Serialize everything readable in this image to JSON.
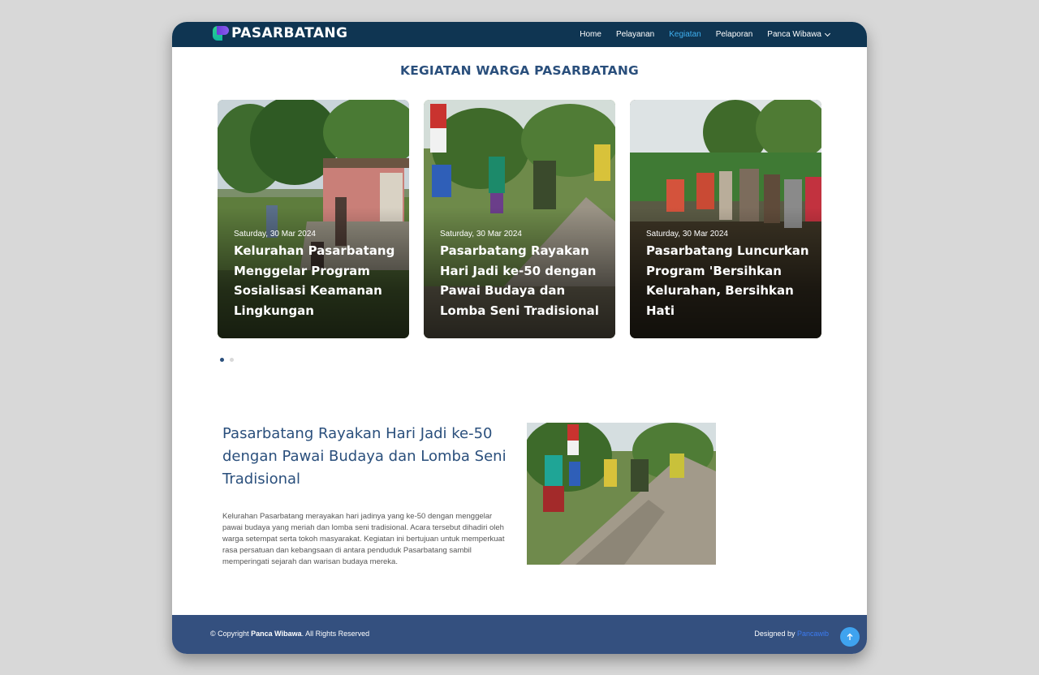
{
  "navbar": {
    "brand": "PASARBATANG",
    "items": [
      {
        "label": "Home",
        "active": false
      },
      {
        "label": "Pelayanan",
        "active": false
      },
      {
        "label": "Kegiatan",
        "active": true
      },
      {
        "label": "Pelaporan",
        "active": false
      },
      {
        "label": "Panca Wibawa",
        "active": false,
        "dropdown": true
      }
    ]
  },
  "section": {
    "title": "KEGIATAN WARGA PASARBATANG"
  },
  "cards": [
    {
      "date": "Saturday, 30 Mar 2024",
      "title": "Kelurahan Pasarbatang Menggelar Program Sosialisasi Keamanan Lingkungan"
    },
    {
      "date": "Saturday, 30 Mar 2024",
      "title": "Pasarbatang Rayakan Hari Jadi ke-50 dengan Pawai Budaya dan Lomba Seni Tradisional"
    },
    {
      "date": "Saturday, 30 Mar 2024",
      "title": "Pasarbatang Luncurkan Program 'Bersihkan Kelurahan, Bersihkan Hati"
    }
  ],
  "carousel": {
    "pages": 2,
    "current": 1
  },
  "article": {
    "title": "Pasarbatang Rayakan Hari Jadi ke-50 dengan Pawai Budaya dan Lomba Seni Tradisional",
    "body": "Kelurahan Pasarbatang merayakan hari jadinya yang ke-50 dengan menggelar pawai budaya yang meriah dan lomba seni tradisional. Acara tersebut dihadiri oleh warga setempat serta tokoh masyarakat. Kegiatan ini bertujuan untuk memperkuat rasa persatuan dan kebangsaan di antara penduduk Pasarbatang sambil memperingati sejarah dan warisan budaya mereka."
  },
  "footer": {
    "copyright_prefix": "© Copyright ",
    "copyright_name": "Panca Wibawa",
    "copyright_suffix": ". All Rights Reserved",
    "designed_prefix": "Designed by ",
    "designed_link": "Pancawib"
  },
  "colors": {
    "navbar": "#0f3552",
    "accent_nav": "#3fb0f0",
    "title": "#2a4f7c",
    "footer": "#34507f",
    "to_top": "#3fa3ef"
  },
  "icons": {
    "logo": "logo-mark-icon",
    "dropdown": "chevron-down-icon",
    "to_top": "arrow-up-icon"
  }
}
